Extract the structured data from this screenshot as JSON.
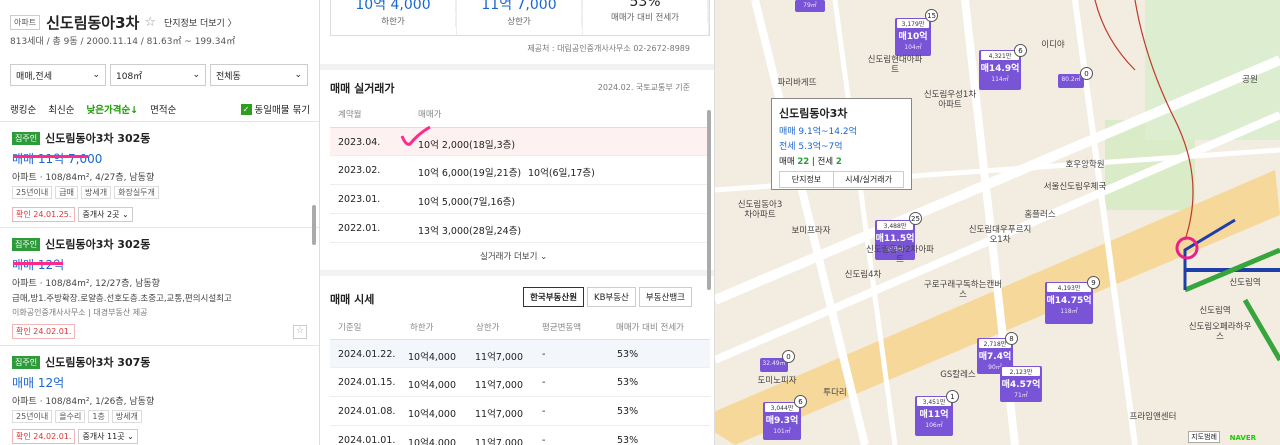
{
  "left": {
    "badge": "아파트",
    "title": "신도림동아3차",
    "star": "☆",
    "complex_link": "단지정보 더보기 〉",
    "info": "813세대 / 총 9동 / 2000.11.14 / 81.63㎡ ~ 199.34㎡",
    "filters": [
      "매매,전세",
      "108㎡",
      "전체동"
    ],
    "sorts": [
      "랭킹순",
      "최신순",
      "낮은가격순↓",
      "면적순"
    ],
    "same_check": "동일매물 묶기",
    "items": [
      {
        "badge": "집주인",
        "title": "신도림동아3차 302동",
        "price": "매매 11억 7,000",
        "detail": "아파트 · 108/84m², 4/27층, 남동향",
        "tags": [
          "25년이내",
          "급매",
          "방세개",
          "화장실두개"
        ],
        "desc": "",
        "confirm": "확인 24.01.25.",
        "broker": "중개사 2곳 ⌄"
      },
      {
        "badge": "집주인",
        "title": "신도림동아3차 302동",
        "price": "매매 12억",
        "detail": "아파트 · 108/84m², 12/27층, 남동향",
        "tags": [],
        "desc": "급매,방1.주방확장.로얄층.선호도층.초중고,교통,편의시설최고",
        "desc2": "이화공인중개사사무소 | 대경부동산 제공",
        "confirm": "확인 24.02.01.",
        "broker": ""
      },
      {
        "badge": "집주인",
        "title": "신도림동아3차 307동",
        "price": "매매 12억",
        "detail": "아파트 · 108/84m², 1/26층, 남동향",
        "tags": [
          "25년이내",
          "올수리",
          "1층",
          "방세개"
        ],
        "desc": "",
        "confirm": "확인 24.02.01.",
        "broker": "중개사 11곳 ⌄"
      }
    ]
  },
  "mid": {
    "summary": [
      {
        "value": "10억 4,000",
        "label": "하한가"
      },
      {
        "value": "11억 7,000",
        "label": "상한가"
      },
      {
        "value": "53%",
        "label": "매매가 대비 전세가"
      }
    ],
    "source": "제공처 : 대림공인중개사사무소 02-2672-8989",
    "deals_title": "매매 실거래가",
    "deals_src": "2024.02. 국토교통부 기준",
    "deals_head": [
      "계약월",
      "매매가"
    ],
    "deals": [
      {
        "month": "2023.04.",
        "p1": "10억 2,000(18일,3층)",
        "p2": ""
      },
      {
        "month": "2023.02.",
        "p1": "10억 6,000(19일,21층)",
        "p2": "10억(6일,17층)"
      },
      {
        "month": "2023.01.",
        "p1": "10억 5,000(7일,16층)",
        "p2": ""
      },
      {
        "month": "2022.01.",
        "p1": "13억 3,000(28일,24층)",
        "p2": ""
      }
    ],
    "deals_more": "실거래가 더보기 ⌄",
    "quote_title": "매매 시세",
    "quote_tabs": [
      "한국부동산원",
      "KB부동산",
      "부동산뱅크"
    ],
    "quote_head": [
      "기준일",
      "하한가",
      "상한가",
      "평균변동액",
      "매매가 대비 전세가"
    ],
    "quotes": [
      {
        "d": "2024.01.22.",
        "lo": "10억4,000",
        "hi": "11억7,000",
        "ch": "-",
        "r": "53%"
      },
      {
        "d": "2024.01.15.",
        "lo": "10억4,000",
        "hi": "11억7,000",
        "ch": "-",
        "r": "53%"
      },
      {
        "d": "2024.01.08.",
        "lo": "10억4,000",
        "hi": "11억7,000",
        "ch": "-",
        "r": "53%"
      },
      {
        "d": "2024.01.01.",
        "lo": "10억4,000",
        "hi": "11억7,000",
        "ch": "-",
        "r": "53%"
      }
    ]
  },
  "popup": {
    "title": "신도림동아3차",
    "sale": "매매 9.1억~14.2억",
    "rent": "전세 5.3억~7억",
    "sale_cnt_lbl": "매매",
    "sale_cnt": "22",
    "rent_cnt_lbl": "전세",
    "rent_cnt": "2",
    "btn1": "단지정보",
    "btn2": "시세/실거래가"
  },
  "markers": [
    {
      "t": "3,179만",
      "p": "매10억",
      "s": "104㎡"
    },
    {
      "t": "4,321만",
      "p": "매14.9억",
      "s": "114㎡"
    },
    {
      "t": "",
      "p": "",
      "s": "80.2㎡"
    },
    {
      "t": "3,488만",
      "p": "매11.5억",
      "s": "109㎡"
    },
    {
      "t": "4,193만",
      "p": "매14.75억",
      "s": "118㎡"
    },
    {
      "t": "",
      "p": "",
      "s": "32.49㎡"
    },
    {
      "t": "2,718만",
      "p": "매7.4억",
      "s": "90㎡"
    },
    {
      "t": "2,123만",
      "p": "매4.57억",
      "s": "71㎡"
    },
    {
      "t": "3,044만",
      "p": "매9.3억",
      "s": "101㎡"
    },
    {
      "t": "3,451만",
      "p": "매11억",
      "s": "106㎡"
    },
    {
      "t": "",
      "p": "",
      "s": "79㎡"
    }
  ],
  "circles": [
    "15",
    "6",
    "0",
    "25",
    "9",
    "8",
    "0",
    "1",
    "6"
  ],
  "labels": [
    "신도림현대아파트",
    "파리바게뜨",
    "신도림우성1차아파트",
    "신도림동아3차아파트",
    "신도림4차",
    "신도림동아2차아파트",
    "구로구래구독하는캔버스",
    "신도림대우푸르지오1차",
    "홈플러스",
    "신도림역",
    "신도림오페라하우스",
    "GS칼레스",
    "투다리",
    "도미노피자",
    "서울신도림우체국",
    "호우앙학원",
    "이디야",
    "보미프라자",
    "공원",
    "신도림역",
    "프라임앤센터"
  ],
  "map_misc": {
    "naver": "NAVER",
    "scale": "지도범례"
  }
}
